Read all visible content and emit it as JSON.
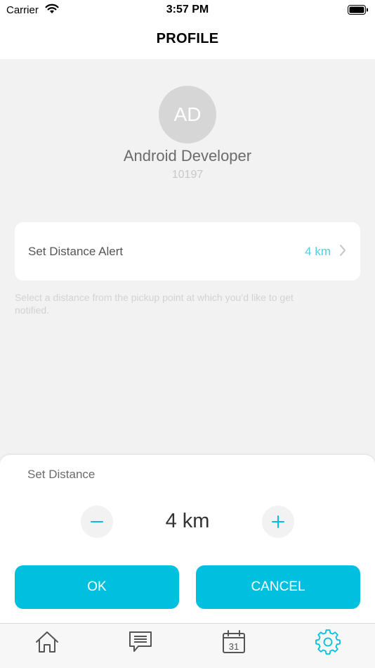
{
  "status_bar": {
    "carrier": "Carrier",
    "time": "3:57 PM"
  },
  "nav": {
    "title": "PROFILE"
  },
  "profile": {
    "initials": "AD",
    "name": "Android Developer",
    "id": "10197"
  },
  "distance_alert": {
    "label": "Set Distance Alert",
    "value": "4 km",
    "hint": "Select a distance from the pickup point at which you’d like to get notified."
  },
  "sheet": {
    "title": "Set Distance",
    "value": "4 km",
    "minus": "−",
    "plus": "+",
    "ok_label": "OK",
    "cancel_label": "CANCEL"
  },
  "tabs": [
    {
      "icon": "home-icon",
      "active": false
    },
    {
      "icon": "chat-icon",
      "active": false
    },
    {
      "icon": "calendar-icon",
      "label": "31",
      "active": false
    },
    {
      "icon": "gear-icon",
      "active": true
    }
  ],
  "colors": {
    "accent": "#00bfdf",
    "value_text": "#55cde6",
    "tab_inactive": "#555555",
    "tab_active": "#00bfdf"
  }
}
